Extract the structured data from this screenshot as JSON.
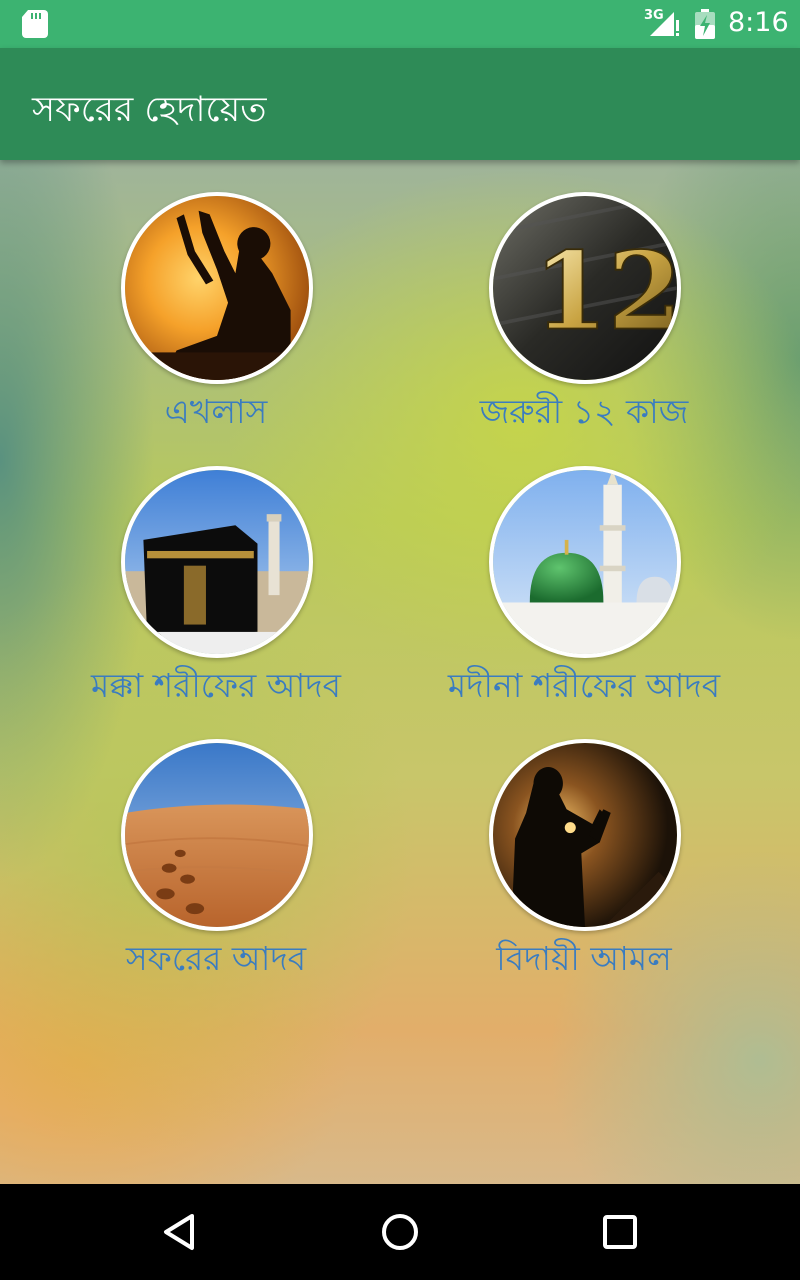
{
  "status_bar": {
    "network_type": "3G",
    "time": "8:16",
    "icons": [
      "sd-card-icon",
      "signal-icon",
      "battery-charging-icon"
    ],
    "color": "#3cb371"
  },
  "app_bar": {
    "title": "সফরের হেদায়েত",
    "color": "#2e8b57"
  },
  "menu": {
    "label_color": "#3a7cc0",
    "items": [
      {
        "label": "এখলাস",
        "image": "praying-silhouette-sunset-image"
      },
      {
        "label": "জরুরী ১২ কাজ",
        "image": "number-12-image"
      },
      {
        "label": "মক্কা শরীফের আদব",
        "image": "kaaba-image"
      },
      {
        "label": "মদীনা শরীফের আদব",
        "image": "green-dome-image"
      },
      {
        "label": "সফরের আদব",
        "image": "desert-footprints-image"
      },
      {
        "label": "বিদায়ী আমল",
        "image": "praying-man-dark-image"
      }
    ]
  },
  "nav_bar": {
    "icons": [
      "back-icon",
      "home-icon",
      "recent-apps-icon"
    ]
  }
}
